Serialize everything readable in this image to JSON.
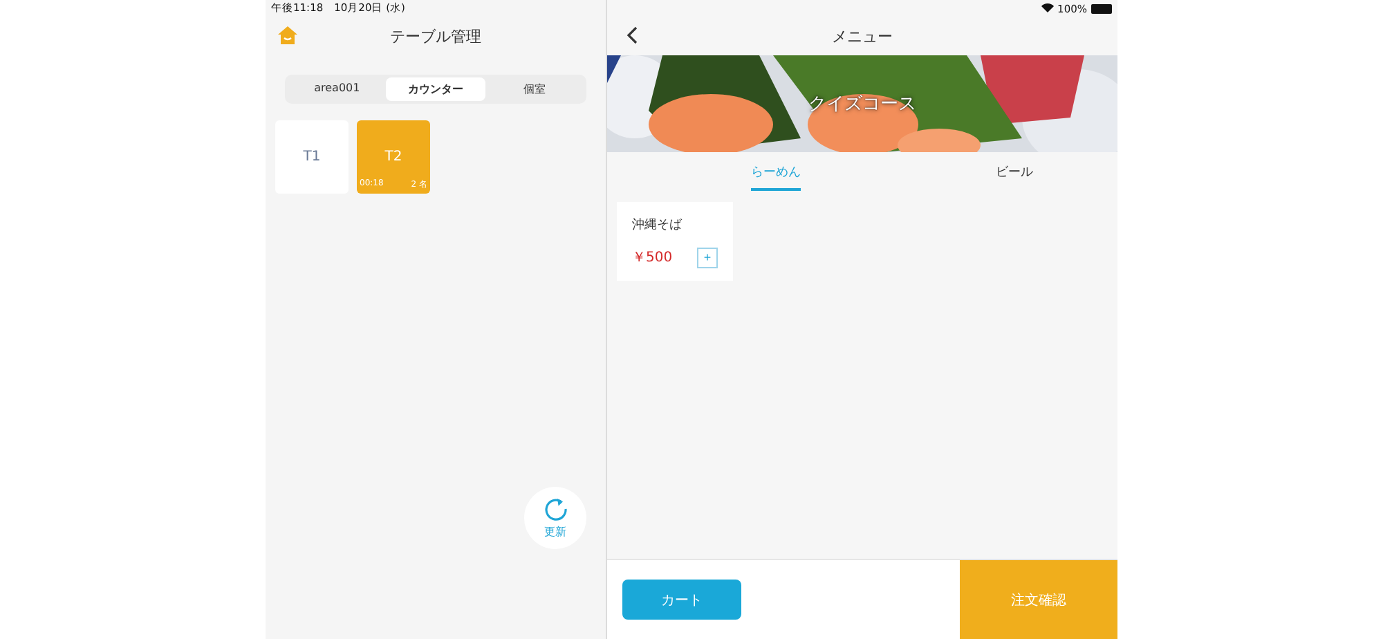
{
  "status_bar": {
    "time": "午後11:18",
    "date": "10月20日 (水)",
    "battery": "100%"
  },
  "left_panel": {
    "title": "テーブル管理",
    "area_tabs": [
      {
        "label": "area001",
        "selected": false
      },
      {
        "label": "カウンター",
        "selected": true
      },
      {
        "label": "個室",
        "selected": false
      }
    ],
    "tables": [
      {
        "name": "T1",
        "occupied": false
      },
      {
        "name": "T2",
        "occupied": true,
        "elapsed": "00:18",
        "guests": "2 名"
      }
    ],
    "refresh_button": "更新"
  },
  "right_panel": {
    "title": "メニュー",
    "banner": {
      "kind": "picture",
      "title": "クイズコース"
    },
    "category_tabs": [
      {
        "label": "らーめん",
        "selected": true
      },
      {
        "label": "ビール",
        "selected": false
      }
    ],
    "items": [
      {
        "name": "沖縄そば",
        "price": "￥500",
        "add": "+"
      }
    ],
    "cart_button": "カート",
    "confirm_button": "注文確認"
  }
}
